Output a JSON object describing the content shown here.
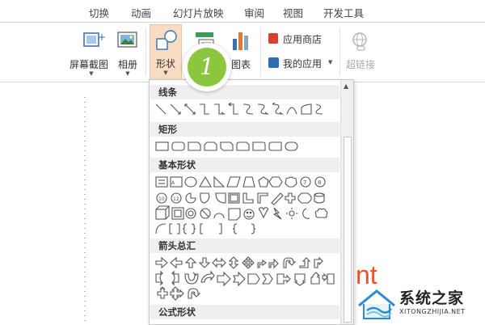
{
  "tabs": [
    {
      "label": "切换"
    },
    {
      "label": "动画"
    },
    {
      "label": "幻灯片放映"
    },
    {
      "label": "审阅"
    },
    {
      "label": "视图"
    },
    {
      "label": "开发工具"
    }
  ],
  "ribbon": {
    "screenshot_label": "屏幕截图",
    "album_label": "相册",
    "shapes_label": "形状",
    "chart_label": "图表",
    "app_store_label": "应用商店",
    "my_apps_label": "我的应用",
    "hyperlink_label": "超链接",
    "group_hint": "链"
  },
  "badge": {
    "number": "1"
  },
  "dropdown": {
    "sections": [
      {
        "title": "线条"
      },
      {
        "title": "矩形"
      },
      {
        "title": "基本形状"
      },
      {
        "title": "箭头总汇"
      },
      {
        "title": "公式形状"
      }
    ]
  },
  "background_text": "nt",
  "logo": {
    "main": "系统之家",
    "sub": "XITONGZHIJIA.NET"
  },
  "colors": {
    "accent_orange": "#f8dcc4",
    "badge_green": "#8cc63e",
    "logo_blue": "#2a8bd6"
  }
}
